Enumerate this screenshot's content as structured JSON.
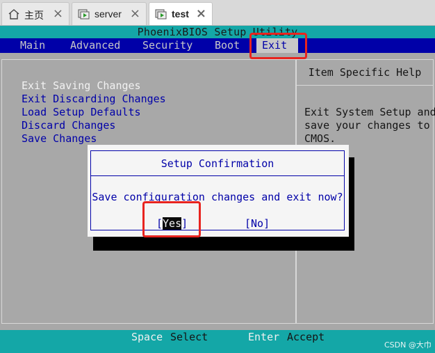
{
  "tabs": [
    {
      "label": "主页",
      "icon": "home-icon"
    },
    {
      "label": "server",
      "icon": "vm-play-icon"
    },
    {
      "label": "test",
      "icon": "vm-play-icon",
      "active": true
    }
  ],
  "bios": {
    "title": "PhoenixBIOS Setup Utility",
    "menu": [
      "Main",
      "Advanced",
      "Security",
      "Boot",
      "Exit"
    ],
    "selected_menu": "Exit",
    "options": [
      "Exit Saving Changes",
      "Exit Discarding Changes",
      "Load Setup Defaults",
      "Discard Changes",
      "Save Changes"
    ],
    "help_header": "Item Specific Help",
    "help_lines": [
      "Exit System Setup and",
      "save your changes to",
      "CMOS."
    ]
  },
  "dialog": {
    "title": "Setup Confirmation",
    "message": "Save configuration changes and exit now?",
    "yes_open": "[",
    "yes_label": "Yes",
    "yes_close": "]",
    "no_label": "[No]"
  },
  "footer": {
    "keys": [
      {
        "key": "Space",
        "action": "Select"
      },
      {
        "key": "Enter",
        "action": "Accept"
      }
    ]
  },
  "watermark": "CSDN @大巾",
  "colors": {
    "bios_blue": "#0000a8",
    "bios_cyan": "#14a7a7",
    "bios_gray": "#a8a8a8",
    "highlight_red": "#e8241f"
  }
}
